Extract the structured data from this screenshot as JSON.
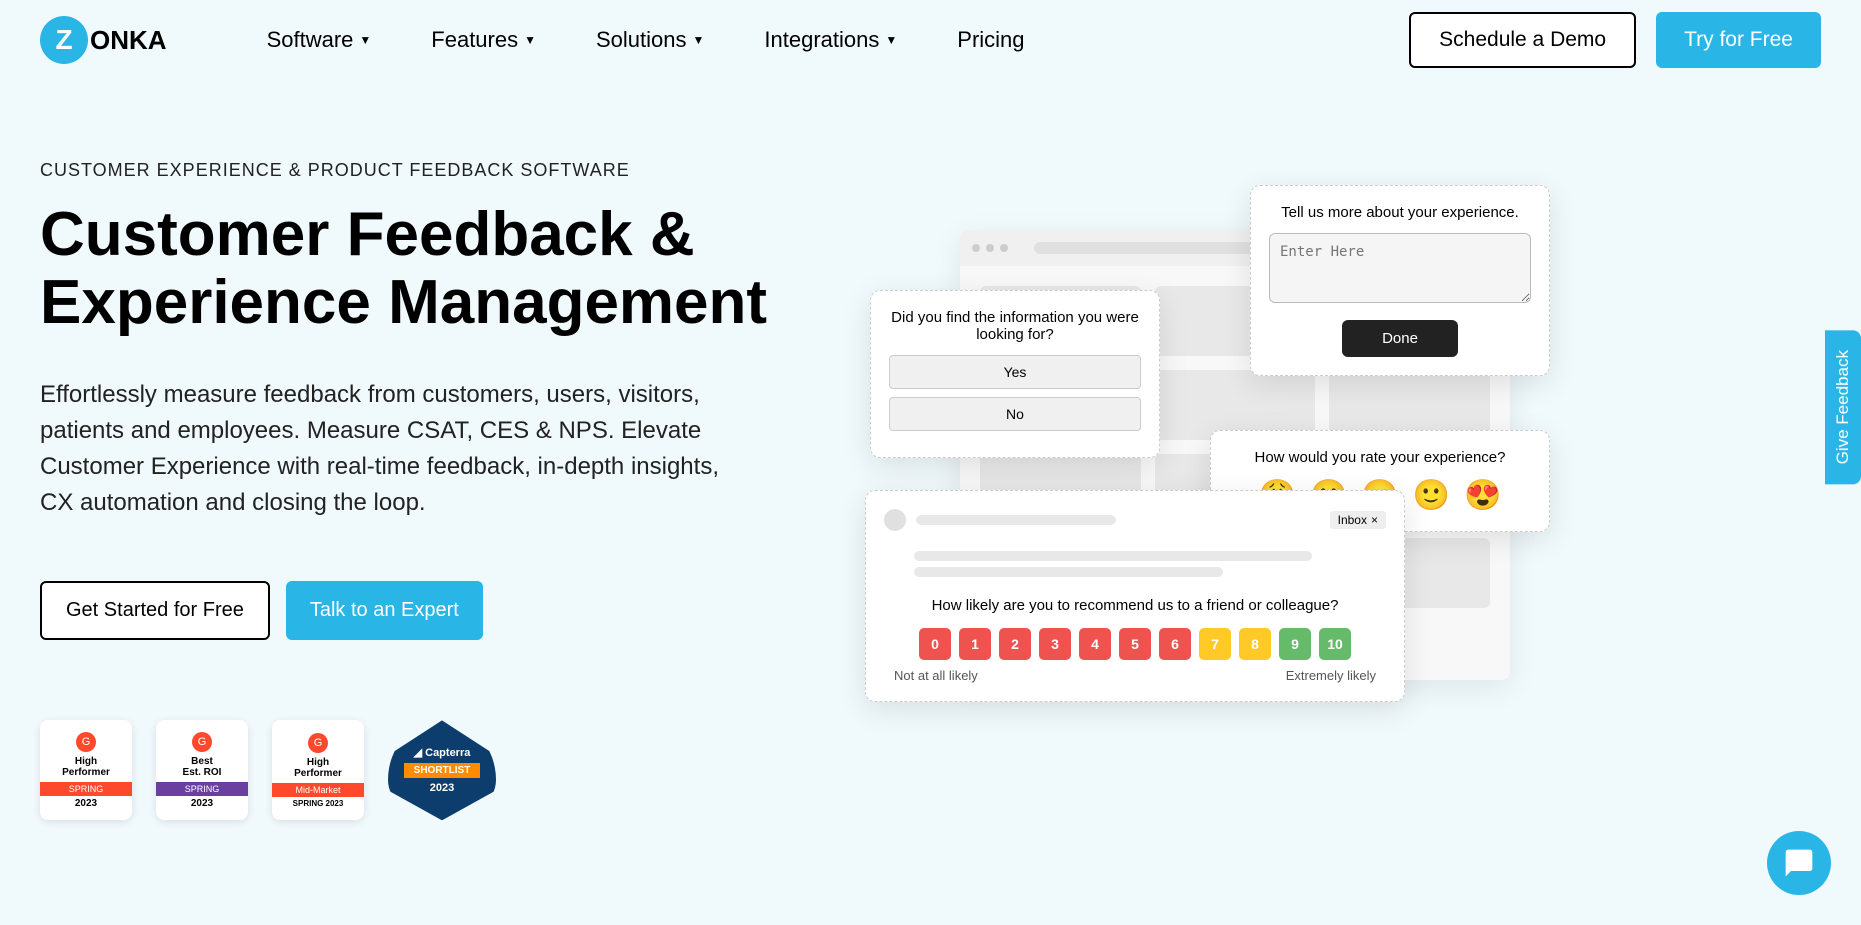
{
  "brand": "ONKA",
  "nav": [
    {
      "label": "Software",
      "dropdown": true
    },
    {
      "label": "Features",
      "dropdown": true
    },
    {
      "label": "Solutions",
      "dropdown": true
    },
    {
      "label": "Integrations",
      "dropdown": true
    },
    {
      "label": "Pricing",
      "dropdown": false
    }
  ],
  "header_cta": {
    "demo": "Schedule a Demo",
    "trial": "Try for Free"
  },
  "hero": {
    "eyebrow": "CUSTOMER EXPERIENCE & PRODUCT FEEDBACK SOFTWARE",
    "title": "Customer Feedback & Experience Management",
    "desc": "Effortlessly measure feedback from customers, users, visitors, patients and employees. Measure CSAT, CES & NPS. Elevate Customer Experience with real-time feedback, in-depth insights, CX automation and closing the loop.",
    "cta1": "Get Started for Free",
    "cta2": "Talk to an Expert"
  },
  "badges": [
    {
      "line1": "High",
      "line2": "Performer",
      "band": "SPRING",
      "band_color": "#ff492c",
      "year": "2023"
    },
    {
      "line1": "Best",
      "line2": "Est. ROI",
      "band": "SPRING",
      "band_color": "#6b3fa0",
      "year": "2023"
    },
    {
      "line1": "High",
      "line2": "Performer",
      "band": "Mid-Market",
      "band_color": "#ff492c",
      "year": "SPRING 2023"
    },
    {
      "type": "capterra",
      "brand": "Capterra",
      "band": "SHORTLIST",
      "year": "2023"
    }
  ],
  "popup1": {
    "q": "Did you find the information you were looking for?",
    "yes": "Yes",
    "no": "No"
  },
  "popup2": {
    "q": "Tell us more about your experience.",
    "placeholder": "Enter Here",
    "done": "Done"
  },
  "popup3": {
    "q": "How would you rate your experience?",
    "emojis": [
      "😩",
      "😕",
      "😐",
      "🙂",
      "😍"
    ]
  },
  "popup4": {
    "inbox": "Inbox",
    "q": "How likely are you to recommend us to a friend or colleague?",
    "scale": [
      "0",
      "1",
      "2",
      "3",
      "4",
      "5",
      "6",
      "7",
      "8",
      "9",
      "10"
    ],
    "colors": [
      "#ef5350",
      "#ef5350",
      "#ef5350",
      "#ef5350",
      "#ef5350",
      "#ef5350",
      "#ef5350",
      "#ffca28",
      "#ffca28",
      "#66bb6a",
      "#66bb6a"
    ],
    "low": "Not at all likely",
    "high": "Extremely likely"
  },
  "feedback_tab": "Give Feedback"
}
